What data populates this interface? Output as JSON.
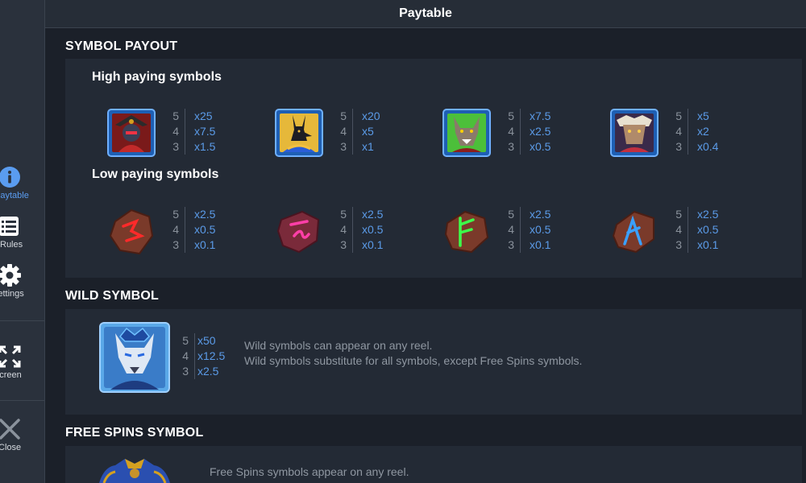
{
  "sidebar": {
    "items": [
      {
        "label": "Paytable",
        "icon": "info-icon"
      },
      {
        "label": "Rules",
        "icon": "list-icon"
      },
      {
        "label": "Settings",
        "icon": "gear-icon"
      },
      {
        "label": "Fullscreen",
        "icon": "fullscreen-icon"
      },
      {
        "label": "Close",
        "icon": "close-icon"
      }
    ]
  },
  "header": {
    "title": "Paytable"
  },
  "symbol_payout": {
    "title": "SYMBOL PAYOUT",
    "high": {
      "title": "High paying symbols",
      "symbols": [
        {
          "counts": [
            "5",
            "4",
            "3"
          ],
          "mults": [
            "x25",
            "x7.5",
            "x1.5"
          ]
        },
        {
          "counts": [
            "5",
            "4",
            "3"
          ],
          "mults": [
            "x20",
            "x5",
            "x1"
          ]
        },
        {
          "counts": [
            "5",
            "4",
            "3"
          ],
          "mults": [
            "x7.5",
            "x2.5",
            "x0.5"
          ]
        },
        {
          "counts": [
            "5",
            "4",
            "3"
          ],
          "mults": [
            "x5",
            "x2",
            "x0.4"
          ]
        }
      ]
    },
    "low": {
      "title": "Low paying symbols",
      "symbols": [
        {
          "counts": [
            "5",
            "4",
            "3"
          ],
          "mults": [
            "x2.5",
            "x0.5",
            "x0.1"
          ]
        },
        {
          "counts": [
            "5",
            "4",
            "3"
          ],
          "mults": [
            "x2.5",
            "x0.5",
            "x0.1"
          ]
        },
        {
          "counts": [
            "5",
            "4",
            "3"
          ],
          "mults": [
            "x2.5",
            "x0.5",
            "x0.1"
          ]
        },
        {
          "counts": [
            "5",
            "4",
            "3"
          ],
          "mults": [
            "x2.5",
            "x0.5",
            "x0.1"
          ]
        }
      ]
    }
  },
  "wild": {
    "title": "WILD SYMBOL",
    "counts": [
      "5",
      "4",
      "3"
    ],
    "mults": [
      "x50",
      "x12.5",
      "x2.5"
    ],
    "desc1": "Wild symbols can appear on any reel.",
    "desc2": "Wild symbols substitute for all symbols, except Free Spins symbols."
  },
  "free_spins": {
    "title": "FREE SPINS SYMBOL",
    "desc1": "Free Spins symbols appear on any reel."
  },
  "colors": {
    "accent": "#5a9cf0",
    "rune_red": "#ff2a2a",
    "rune_pink": "#ff3fa8",
    "rune_green": "#3cff4a",
    "rune_blue": "#3aa0ff"
  }
}
